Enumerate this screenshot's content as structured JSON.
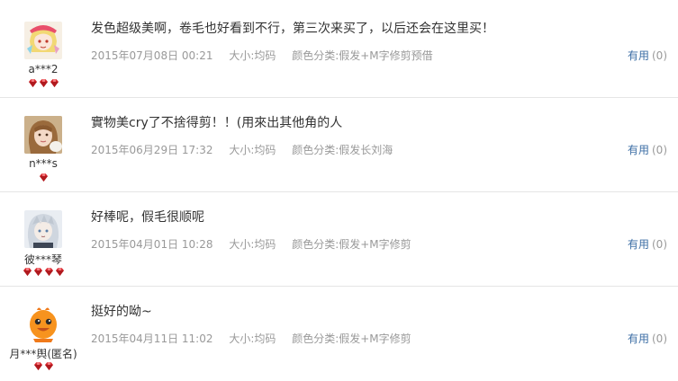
{
  "reviews": [
    {
      "username": "a***2",
      "level": 3,
      "avatar": "anime-blonde-avatar",
      "comment": "发色超级美啊，卷毛也好看到不行，第三次来买了，以后还会在这里买！",
      "date": "2015年07月08日 00:21",
      "size": "大小:均码",
      "color": "颜色分类:假发+M字修剪预借",
      "helpful_label": "有用",
      "helpful_count": "(0)"
    },
    {
      "username": "n***s",
      "level": 1,
      "avatar": "photo-girl-avatar",
      "comment": "實物美cry了不捨得剪！！(用來出其他角的人",
      "date": "2015年06月29日 17:32",
      "size": "大小:均码",
      "color": "颜色分类:假发长刘海",
      "helpful_label": "有用",
      "helpful_count": "(0)"
    },
    {
      "username": "彼***琴",
      "level": 4,
      "avatar": "anime-silver-hair-avatar",
      "comment": "好棒呢，假毛很顺呢",
      "date": "2015年04月01日 10:28",
      "size": "大小:均码",
      "color": "颜色分类:假发+M字修剪",
      "helpful_label": "有用",
      "helpful_count": "(0)"
    },
    {
      "username": "月***舆(匿名)",
      "level": 2,
      "avatar": "anonymous-orange-avatar",
      "comment": "挺好的呦~",
      "date": "2015年04月11日 11:02",
      "size": "大小:均码",
      "color": "颜色分类:假发+M字修剪",
      "helpful_label": "有用",
      "helpful_count": "(0)"
    }
  ],
  "colors": {
    "link": "#3c6ea5",
    "meta": "#999999",
    "gem": "#d4242a",
    "divider": "#e5e5e5"
  }
}
